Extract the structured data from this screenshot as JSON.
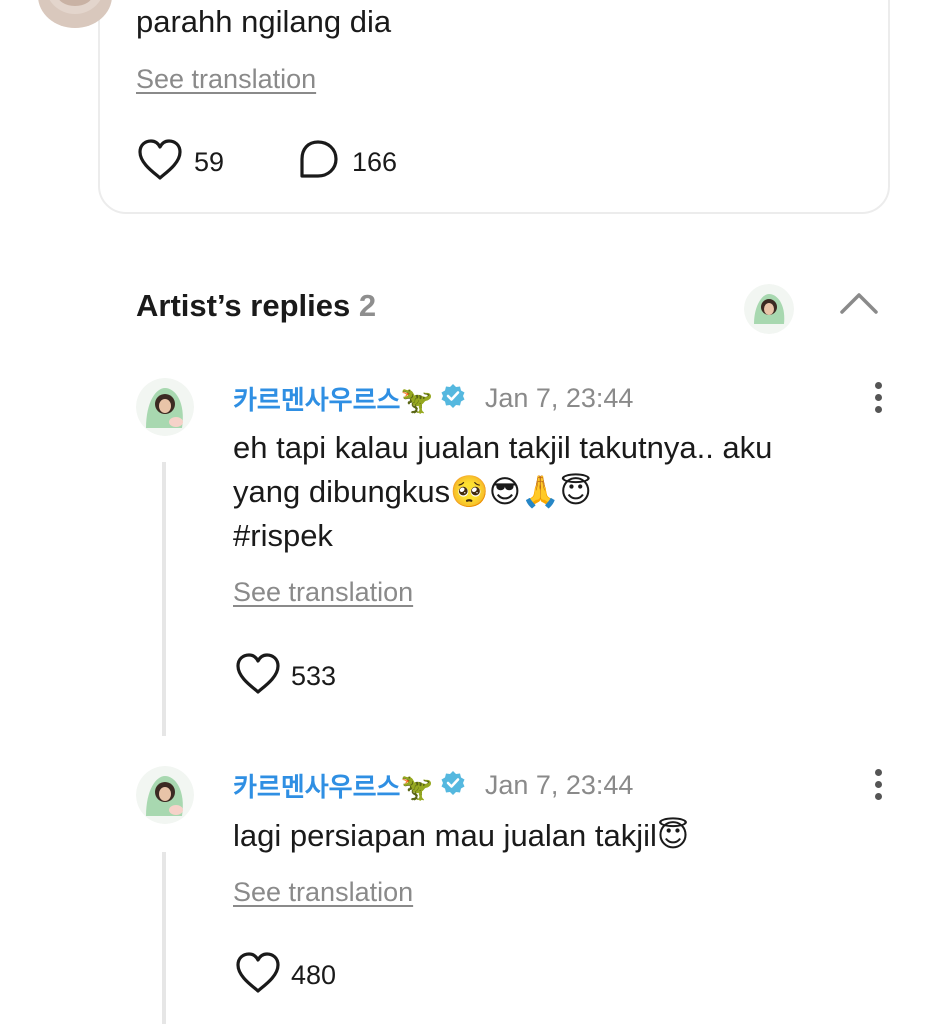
{
  "top_comment": {
    "text": "parahh ngilang dia",
    "see_translation": "See translation",
    "like_count": "59",
    "comment_count": "166"
  },
  "artist_replies": {
    "title": "Artist’s replies",
    "count": "2"
  },
  "replies": [
    {
      "author": "카르멘사우르스🦖",
      "timestamp": "Jan 7, 23:44",
      "line1": "eh tapi kalau jualan takjil takutnya.. aku",
      "line2": "yang dibungkus🥺😎🙏😇",
      "line3": "#rispek",
      "see_translation": "See translation",
      "like_count": "533"
    },
    {
      "author": "카르멘사우르스🦖",
      "timestamp": "Jan 7, 23:44",
      "line1": "lagi persiapan mau jualan takjil😇",
      "see_translation": "See translation",
      "like_count": "480"
    }
  ],
  "colors": {
    "author": "#2f8fe3",
    "verified": "#55b8df",
    "muted": "#8a8a8a",
    "thread_line": "#e6e6e6"
  },
  "icons": [
    "heart-icon",
    "comment-icon",
    "chevron-up-icon",
    "verified-badge-icon",
    "more-options-icon"
  ]
}
